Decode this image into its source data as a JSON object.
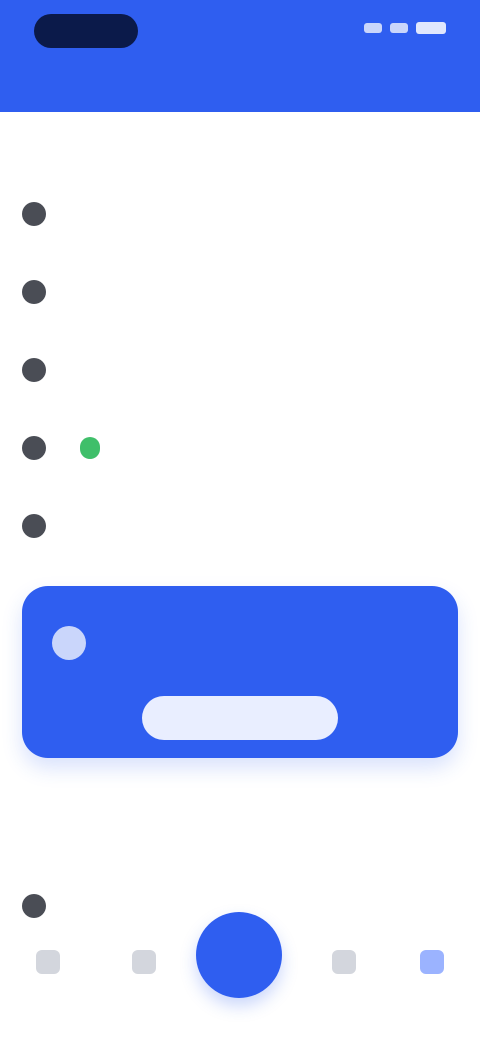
{
  "header": {
    "badge_text": "",
    "title": ""
  },
  "sections": {
    "primary_label": "",
    "secondary_label": ""
  },
  "menu": {
    "items": [
      {
        "label": ""
      },
      {
        "label": ""
      },
      {
        "label": ""
      },
      {
        "label": "",
        "badge": ""
      },
      {
        "label": ""
      }
    ]
  },
  "secondary_menu": {
    "items": [
      {
        "label": ""
      }
    ]
  },
  "promo": {
    "text": "",
    "button_label": "",
    "note": ""
  },
  "colors": {
    "primary": "#2f5ef0",
    "success": "#3fbf6a",
    "badge_dark": "#0b1a4a"
  },
  "icons": {
    "menu": [
      "menu-icon",
      "menu-icon",
      "menu-icon",
      "menu-icon",
      "menu-icon"
    ],
    "bottom_nav": [
      "home-icon",
      "list-icon",
      "plus-icon",
      "stats-icon",
      "profile-icon"
    ]
  }
}
